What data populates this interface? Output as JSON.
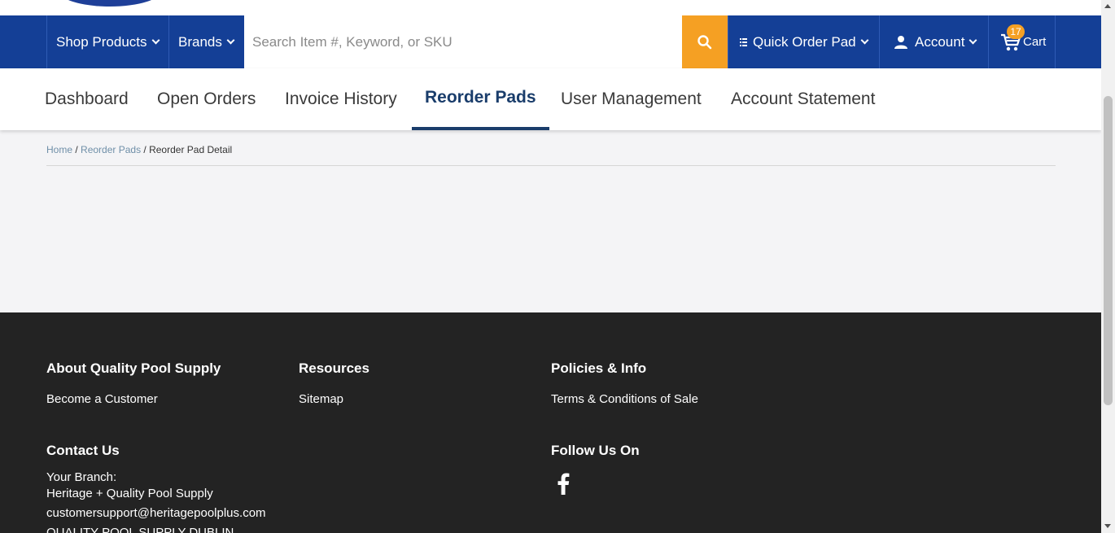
{
  "header": {
    "shop_products": "Shop Products",
    "brands": "Brands",
    "search_placeholder": "Search Item #, Keyword, or SKU",
    "quick_order_pad": "Quick Order Pad",
    "account": "Account",
    "cart_label": "Cart",
    "cart_count": "17",
    "colors": {
      "nav_bg": "#143f96",
      "search_btn": "#f5a023",
      "badge": "#f5a023"
    }
  },
  "subnav": {
    "tabs": [
      {
        "label": "Dashboard"
      },
      {
        "label": "Open Orders"
      },
      {
        "label": "Invoice History"
      },
      {
        "label": "Reorder Pads",
        "active": true
      },
      {
        "label": "User Management"
      },
      {
        "label": "Account Statement"
      }
    ]
  },
  "breadcrumb": {
    "home": "Home",
    "reorder_pads": "Reorder Pads",
    "current": "Reorder Pad Detail",
    "separator": " / "
  },
  "footer": {
    "about_heading": "About Quality Pool Supply",
    "about_link": "Become a Customer",
    "resources_heading": "Resources",
    "resources_link": "Sitemap",
    "policies_heading": "Policies & Info",
    "policies_link": "Terms & Conditions of Sale",
    "contact_heading": "Contact Us",
    "contact_branch_label": "Your Branch:",
    "contact_branch_name": "Heritage + Quality Pool Supply",
    "contact_email": "customersupport@heritagepoolplus.com",
    "contact_branch_code": "QUALITY POOL SUPPLY DUBLIN",
    "follow_heading": "Follow Us On",
    "social_icon": "facebook-icon"
  }
}
